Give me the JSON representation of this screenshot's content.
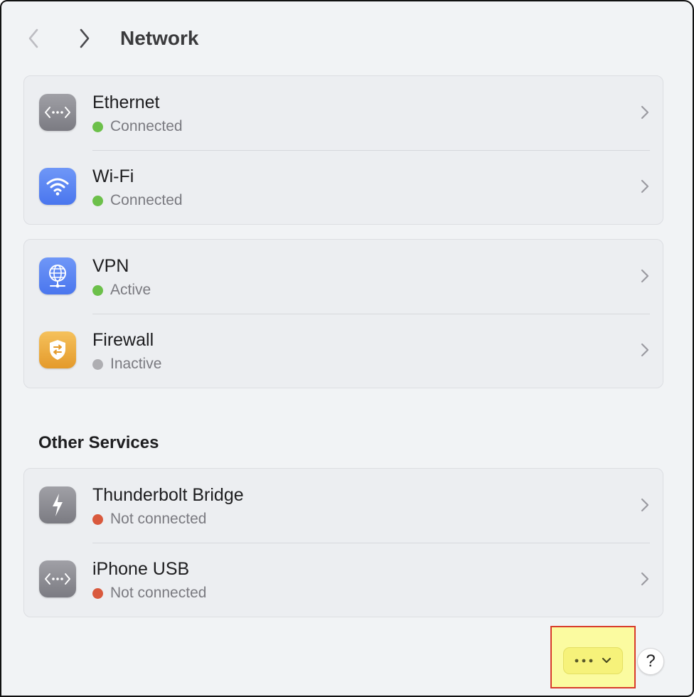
{
  "header": {
    "title": "Network",
    "back_icon": "chevron-left-icon",
    "forward_icon": "chevron-right-icon"
  },
  "groups": [
    {
      "items": [
        {
          "title": "Ethernet",
          "status": "Connected",
          "status_color": "#6cc04a",
          "icon": "ethernet-icon"
        },
        {
          "title": "Wi-Fi",
          "status": "Connected",
          "status_color": "#6cc04a",
          "icon": "wifi-icon"
        }
      ]
    },
    {
      "items": [
        {
          "title": "VPN",
          "status": "Active",
          "status_color": "#6cc04a",
          "icon": "vpn-globe-icon"
        },
        {
          "title": "Firewall",
          "status": "Inactive",
          "status_color": "#aeaeb2",
          "icon": "firewall-shield-icon"
        }
      ]
    }
  ],
  "other_services": {
    "title": "Other Services",
    "items": [
      {
        "title": "Thunderbolt Bridge",
        "status": "Not connected",
        "status_color": "#d9593d",
        "icon": "thunderbolt-icon"
      },
      {
        "title": "iPhone USB",
        "status": "Not connected",
        "status_color": "#d9593d",
        "icon": "ethernet-icon"
      }
    ]
  },
  "footer": {
    "more_button_icon": "ellipsis-icon",
    "more_chevron_icon": "chevron-down-icon",
    "help_label": "?"
  },
  "colors": {
    "highlight_fill": "#fbfba0",
    "highlight_border": "#d83b2a"
  }
}
